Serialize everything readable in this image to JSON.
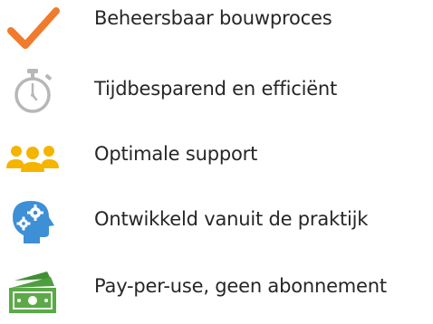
{
  "features": [
    {
      "icon": "checkmark-icon",
      "label": "Beheersbaar bouwproces",
      "color": "#F07B2D"
    },
    {
      "icon": "stopwatch-icon",
      "label": "Tijdbesparend en efficiënt",
      "color": "#B7B7B7"
    },
    {
      "icon": "people-group-icon",
      "label": "Optimale support",
      "color": "#F5B400"
    },
    {
      "icon": "head-gears-icon",
      "label": "Ontwikkeld vanuit de praktijk",
      "color": "#3D8FD6"
    },
    {
      "icon": "money-icon",
      "label": "Pay-per-use, geen abonnement",
      "color": "#5BAA47"
    }
  ]
}
